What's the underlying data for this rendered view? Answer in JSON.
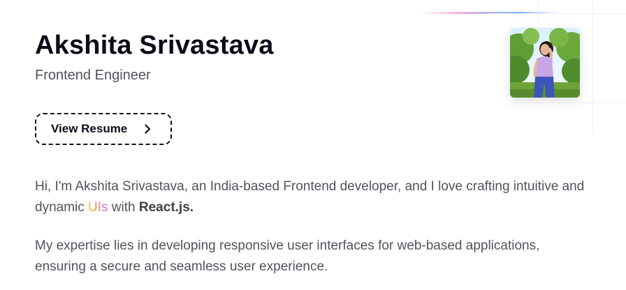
{
  "profile": {
    "name": "Akshita Srivastava",
    "role": "Frontend Engineer",
    "resume_label": "View Resume"
  },
  "bio": {
    "p1_part1": "Hi, I'm Akshita Srivastava, an India-based Frontend developer, and I love crafting intuitive and dynamic ",
    "p1_highlight": "UIs",
    "p1_part2": " with ",
    "p1_strong": "React.js.",
    "p2": "My expertise lies in developing responsive user interfaces for web-based applications, ensuring a secure and seamless user experience."
  },
  "icons": {
    "resume_arrow": "chevron-right-icon"
  },
  "colors": {
    "heading": "#0b0b18",
    "muted_text": "#52525e",
    "highlight_gradient": [
      "#f2c230",
      "#e06dc0"
    ]
  }
}
